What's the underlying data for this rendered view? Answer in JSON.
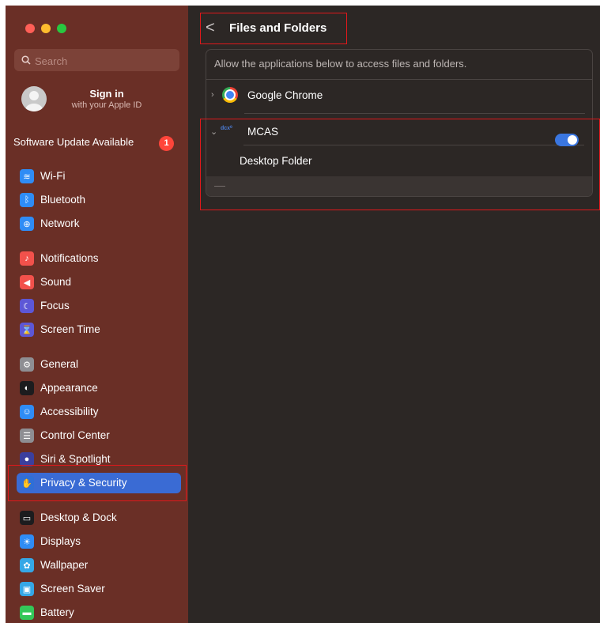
{
  "window": {
    "traffic_lights": [
      "close",
      "minimize",
      "zoom"
    ]
  },
  "sidebar": {
    "search_placeholder": "Search",
    "account": {
      "title": "Sign in",
      "subtitle": "with your Apple ID"
    },
    "software_update": {
      "label": "Software Update Available",
      "badge": "1"
    },
    "items": [
      {
        "label": "Wi-Fi",
        "icon": "wifi-icon",
        "color": "#2f8cf5"
      },
      {
        "label": "Bluetooth",
        "icon": "bluetooth-icon",
        "color": "#2f8cf5"
      },
      {
        "label": "Network",
        "icon": "globe-icon",
        "color": "#2f8cf5"
      },
      {
        "label": "Notifications",
        "icon": "bell-icon",
        "color": "#f2514b"
      },
      {
        "label": "Sound",
        "icon": "speaker-icon",
        "color": "#f2514b"
      },
      {
        "label": "Focus",
        "icon": "moon-icon",
        "color": "#5d57d6"
      },
      {
        "label": "Screen Time",
        "icon": "hourglass-icon",
        "color": "#5d57d6"
      },
      {
        "label": "General",
        "icon": "gear-icon",
        "color": "#8e8e93"
      },
      {
        "label": "Appearance",
        "icon": "appearance-icon",
        "color": "#1c1c1e"
      },
      {
        "label": "Accessibility",
        "icon": "accessibility-icon",
        "color": "#2f8cf5"
      },
      {
        "label": "Control Center",
        "icon": "control-center-icon",
        "color": "#8e8e93"
      },
      {
        "label": "Siri & Spotlight",
        "icon": "siri-icon",
        "color": "#3b3f9e"
      },
      {
        "label": "Privacy & Security",
        "icon": "hand-icon",
        "color": "#2f6fd6",
        "active": true
      },
      {
        "label": "Desktop & Dock",
        "icon": "dock-icon",
        "color": "#1c1c1e"
      },
      {
        "label": "Displays",
        "icon": "sun-icon",
        "color": "#2f8cf5"
      },
      {
        "label": "Wallpaper",
        "icon": "wallpaper-icon",
        "color": "#35a7e6"
      },
      {
        "label": "Screen Saver",
        "icon": "screen-saver-icon",
        "color": "#35a7e6"
      },
      {
        "label": "Battery",
        "icon": "battery-icon",
        "color": "#34c759"
      }
    ]
  },
  "header": {
    "back_label": "<",
    "title": "Files and Folders"
  },
  "panel": {
    "description": "Allow the applications below to access files and folders.",
    "apps": [
      {
        "name": "Google Chrome",
        "expanded": false,
        "icon": "chrome-icon"
      },
      {
        "name": "MCAS",
        "expanded": true,
        "icon": "mcas-logo-icon",
        "logo_text": "dcx⁰",
        "permissions": [
          {
            "label": "Desktop Folder",
            "enabled": true
          }
        ]
      }
    ],
    "footer_minus": "—"
  },
  "colors": {
    "sidebar_bg": "#6a2f26",
    "content_bg": "#2c2725",
    "accent": "#3a6bd4",
    "highlight_outline": "#e0181b"
  }
}
